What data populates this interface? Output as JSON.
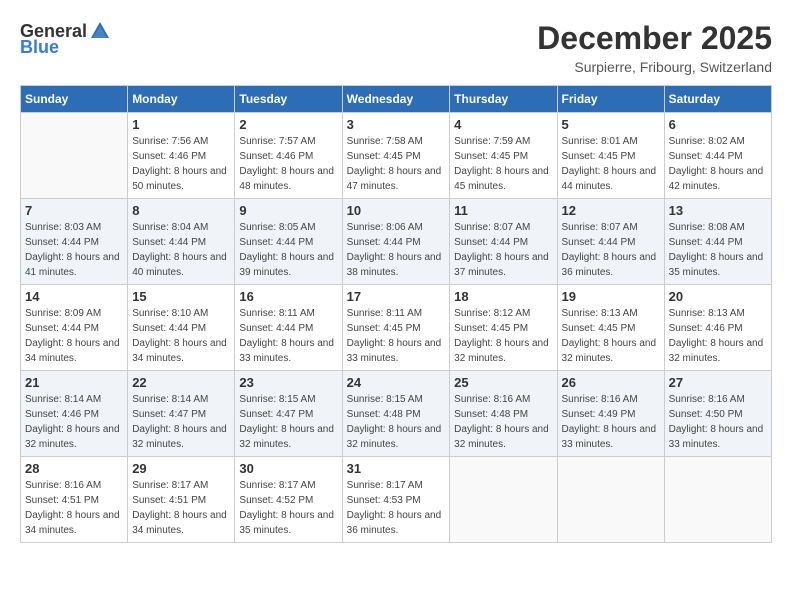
{
  "logo": {
    "general": "General",
    "blue": "Blue"
  },
  "title": "December 2025",
  "subtitle": "Surpierre, Fribourg, Switzerland",
  "weekdays": [
    "Sunday",
    "Monday",
    "Tuesday",
    "Wednesday",
    "Thursday",
    "Friday",
    "Saturday"
  ],
  "weeks": [
    [
      {
        "day": "",
        "sunrise": "",
        "sunset": "",
        "daylight": ""
      },
      {
        "day": "1",
        "sunrise": "7:56 AM",
        "sunset": "4:46 PM",
        "daylight": "8 hours and 50 minutes."
      },
      {
        "day": "2",
        "sunrise": "7:57 AM",
        "sunset": "4:46 PM",
        "daylight": "8 hours and 48 minutes."
      },
      {
        "day": "3",
        "sunrise": "7:58 AM",
        "sunset": "4:45 PM",
        "daylight": "8 hours and 47 minutes."
      },
      {
        "day": "4",
        "sunrise": "7:59 AM",
        "sunset": "4:45 PM",
        "daylight": "8 hours and 45 minutes."
      },
      {
        "day": "5",
        "sunrise": "8:01 AM",
        "sunset": "4:45 PM",
        "daylight": "8 hours and 44 minutes."
      },
      {
        "day": "6",
        "sunrise": "8:02 AM",
        "sunset": "4:44 PM",
        "daylight": "8 hours and 42 minutes."
      }
    ],
    [
      {
        "day": "7",
        "sunrise": "8:03 AM",
        "sunset": "4:44 PM",
        "daylight": "8 hours and 41 minutes."
      },
      {
        "day": "8",
        "sunrise": "8:04 AM",
        "sunset": "4:44 PM",
        "daylight": "8 hours and 40 minutes."
      },
      {
        "day": "9",
        "sunrise": "8:05 AM",
        "sunset": "4:44 PM",
        "daylight": "8 hours and 39 minutes."
      },
      {
        "day": "10",
        "sunrise": "8:06 AM",
        "sunset": "4:44 PM",
        "daylight": "8 hours and 38 minutes."
      },
      {
        "day": "11",
        "sunrise": "8:07 AM",
        "sunset": "4:44 PM",
        "daylight": "8 hours and 37 minutes."
      },
      {
        "day": "12",
        "sunrise": "8:07 AM",
        "sunset": "4:44 PM",
        "daylight": "8 hours and 36 minutes."
      },
      {
        "day": "13",
        "sunrise": "8:08 AM",
        "sunset": "4:44 PM",
        "daylight": "8 hours and 35 minutes."
      }
    ],
    [
      {
        "day": "14",
        "sunrise": "8:09 AM",
        "sunset": "4:44 PM",
        "daylight": "8 hours and 34 minutes."
      },
      {
        "day": "15",
        "sunrise": "8:10 AM",
        "sunset": "4:44 PM",
        "daylight": "8 hours and 34 minutes."
      },
      {
        "day": "16",
        "sunrise": "8:11 AM",
        "sunset": "4:44 PM",
        "daylight": "8 hours and 33 minutes."
      },
      {
        "day": "17",
        "sunrise": "8:11 AM",
        "sunset": "4:45 PM",
        "daylight": "8 hours and 33 minutes."
      },
      {
        "day": "18",
        "sunrise": "8:12 AM",
        "sunset": "4:45 PM",
        "daylight": "8 hours and 32 minutes."
      },
      {
        "day": "19",
        "sunrise": "8:13 AM",
        "sunset": "4:45 PM",
        "daylight": "8 hours and 32 minutes."
      },
      {
        "day": "20",
        "sunrise": "8:13 AM",
        "sunset": "4:46 PM",
        "daylight": "8 hours and 32 minutes."
      }
    ],
    [
      {
        "day": "21",
        "sunrise": "8:14 AM",
        "sunset": "4:46 PM",
        "daylight": "8 hours and 32 minutes."
      },
      {
        "day": "22",
        "sunrise": "8:14 AM",
        "sunset": "4:47 PM",
        "daylight": "8 hours and 32 minutes."
      },
      {
        "day": "23",
        "sunrise": "8:15 AM",
        "sunset": "4:47 PM",
        "daylight": "8 hours and 32 minutes."
      },
      {
        "day": "24",
        "sunrise": "8:15 AM",
        "sunset": "4:48 PM",
        "daylight": "8 hours and 32 minutes."
      },
      {
        "day": "25",
        "sunrise": "8:16 AM",
        "sunset": "4:48 PM",
        "daylight": "8 hours and 32 minutes."
      },
      {
        "day": "26",
        "sunrise": "8:16 AM",
        "sunset": "4:49 PM",
        "daylight": "8 hours and 33 minutes."
      },
      {
        "day": "27",
        "sunrise": "8:16 AM",
        "sunset": "4:50 PM",
        "daylight": "8 hours and 33 minutes."
      }
    ],
    [
      {
        "day": "28",
        "sunrise": "8:16 AM",
        "sunset": "4:51 PM",
        "daylight": "8 hours and 34 minutes."
      },
      {
        "day": "29",
        "sunrise": "8:17 AM",
        "sunset": "4:51 PM",
        "daylight": "8 hours and 34 minutes."
      },
      {
        "day": "30",
        "sunrise": "8:17 AM",
        "sunset": "4:52 PM",
        "daylight": "8 hours and 35 minutes."
      },
      {
        "day": "31",
        "sunrise": "8:17 AM",
        "sunset": "4:53 PM",
        "daylight": "8 hours and 36 minutes."
      },
      {
        "day": "",
        "sunrise": "",
        "sunset": "",
        "daylight": ""
      },
      {
        "day": "",
        "sunrise": "",
        "sunset": "",
        "daylight": ""
      },
      {
        "day": "",
        "sunrise": "",
        "sunset": "",
        "daylight": ""
      }
    ]
  ]
}
